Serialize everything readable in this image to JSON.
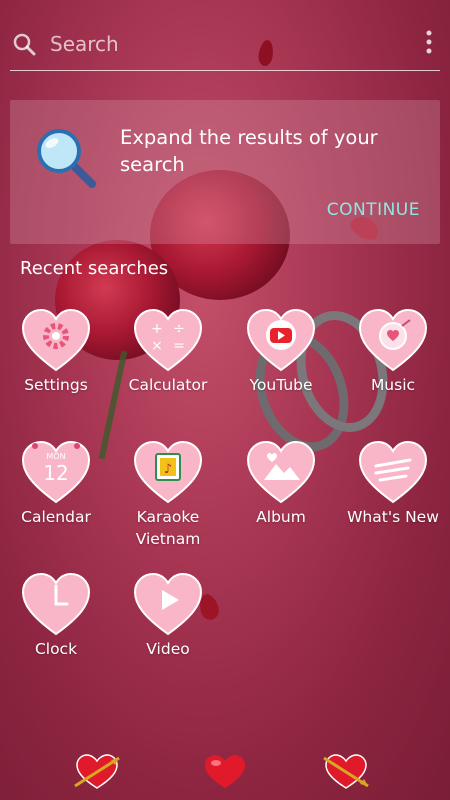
{
  "search": {
    "placeholder": "Search"
  },
  "promo": {
    "text": "Expand the results of your search",
    "action_label": "CONTINUE"
  },
  "recent": {
    "title": "Recent searches"
  },
  "apps": [
    {
      "label": "Settings",
      "icon": "gear-icon"
    },
    {
      "label": "Calculator",
      "icon": "calculator-icon"
    },
    {
      "label": "YouTube",
      "icon": "youtube-icon"
    },
    {
      "label": "Music",
      "icon": "music-icon"
    },
    {
      "label": "Calendar",
      "icon": "calendar-icon",
      "month": "MON",
      "day": "12"
    },
    {
      "label": "Karaoke Vietnam",
      "icon": "karaoke-icon"
    },
    {
      "label": "Album",
      "icon": "album-icon"
    },
    {
      "label": "What's New",
      "icon": "whats-new-icon"
    },
    {
      "label": "Clock",
      "icon": "clock-icon"
    },
    {
      "label": "Video",
      "icon": "video-icon"
    }
  ],
  "dock": [
    {
      "icon": "heart-arrow-icon"
    },
    {
      "icon": "heart-icon"
    },
    {
      "icon": "heart-arrow-icon"
    }
  ],
  "colors": {
    "accent": "#8fe6e0",
    "heart_pink": "#f7a9c0",
    "background": "#a73653"
  }
}
